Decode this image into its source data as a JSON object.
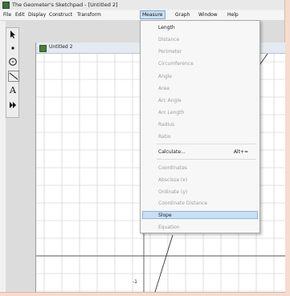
{
  "window": {
    "title": "The Geometer's Sketchpad - [Untitled 2]"
  },
  "menubar": [
    "File",
    "Edit",
    "Display",
    "Construct",
    "Transform",
    "Measure",
    "Graph",
    "Window",
    "Help"
  ],
  "document": {
    "title": "Untitled 2"
  },
  "tools": [
    "arrow-tool-icon",
    "point-tool-icon",
    "compass-tool-icon",
    "straightedge-tool-icon",
    "text-tool-icon",
    "custom-tool-icon"
  ],
  "measure_menu": {
    "items": [
      {
        "label": "Length",
        "enabled": true
      },
      {
        "label": "Distance",
        "enabled": false
      },
      {
        "label": "Perimeter",
        "enabled": false
      },
      {
        "label": "Circumference",
        "enabled": false
      },
      {
        "label": "Angle",
        "enabled": false
      },
      {
        "label": "Area",
        "enabled": false
      },
      {
        "label": "Arc Angle",
        "enabled": false
      },
      {
        "label": "Arc Length",
        "enabled": false
      },
      {
        "label": "Radius",
        "enabled": false
      },
      {
        "label": "Ratio",
        "enabled": false
      },
      {
        "label": "Calculate...",
        "enabled": true,
        "shortcut": "Alt+="
      },
      {
        "label": "Coordinates",
        "enabled": false
      },
      {
        "label": "Abscissa (x)",
        "enabled": false
      },
      {
        "label": "Ordinate (y)",
        "enabled": false
      },
      {
        "label": "Coordinate Distance",
        "enabled": false
      },
      {
        "label": "Slope",
        "enabled": true,
        "highlighted": true
      },
      {
        "label": "Equation",
        "enabled": false
      }
    ]
  },
  "axis_label": "-1",
  "colors": {
    "highlight": "#c9dff5",
    "menu_bg": "#f7f7f7",
    "disabled_text": "#9c9c9c"
  }
}
